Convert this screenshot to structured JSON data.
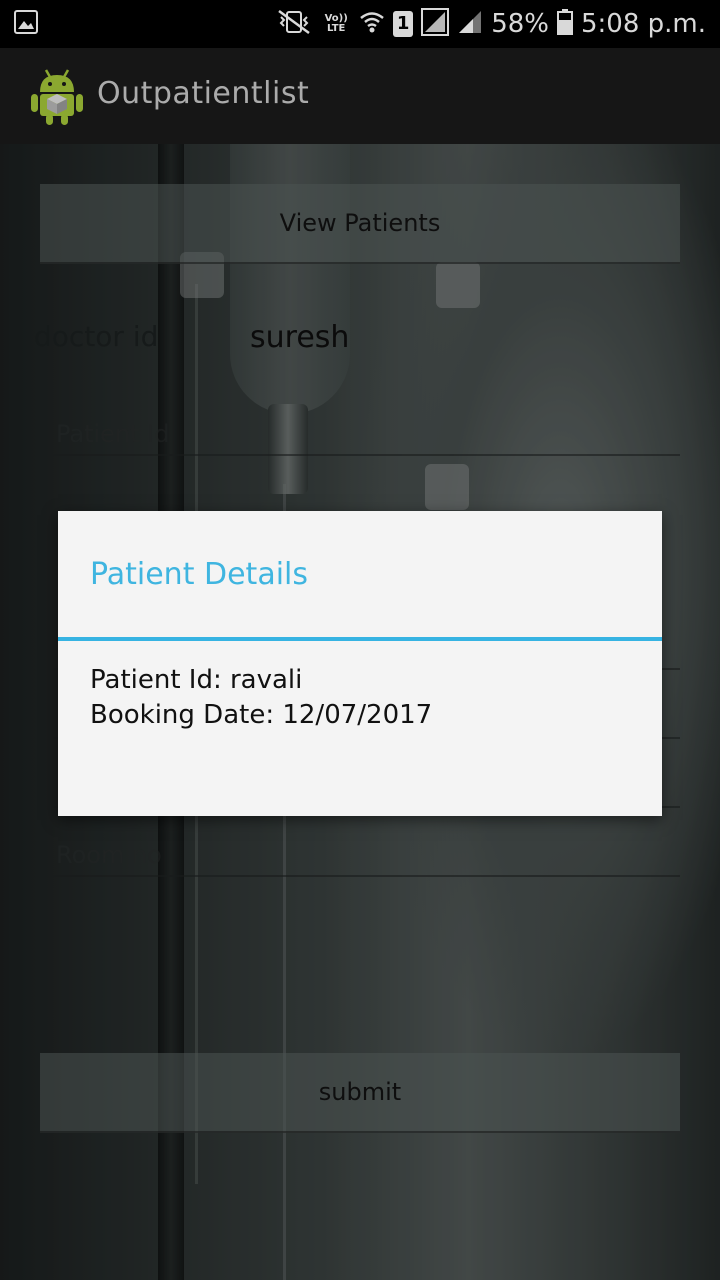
{
  "status_bar": {
    "battery": "58%",
    "time": "5:08 p.m.",
    "sim_slot": "1",
    "volte_label": "Vo)) LTE",
    "icons": [
      "gallery-icon",
      "mute-vibrate-icon",
      "volte-icon",
      "wifi-icon",
      "sim-icon",
      "signal-icon",
      "signal-icon",
      "battery-icon"
    ]
  },
  "app_bar": {
    "title": "Outpatientlist",
    "icon": "android-icon"
  },
  "form": {
    "view_patients_label": "View Patients",
    "doctor_id_label": "doctor id",
    "doctor_id_value": "suresh",
    "patient_id_placeholder": "Patient Id",
    "room_placeholder": "Room no",
    "submit_label": "submit"
  },
  "dialog": {
    "title": "Patient Details",
    "patient_id_line": "Patient Id: ravali",
    "booking_date_line": "Booking Date: 12/07/2017",
    "accent_color": "#36b3e2"
  }
}
